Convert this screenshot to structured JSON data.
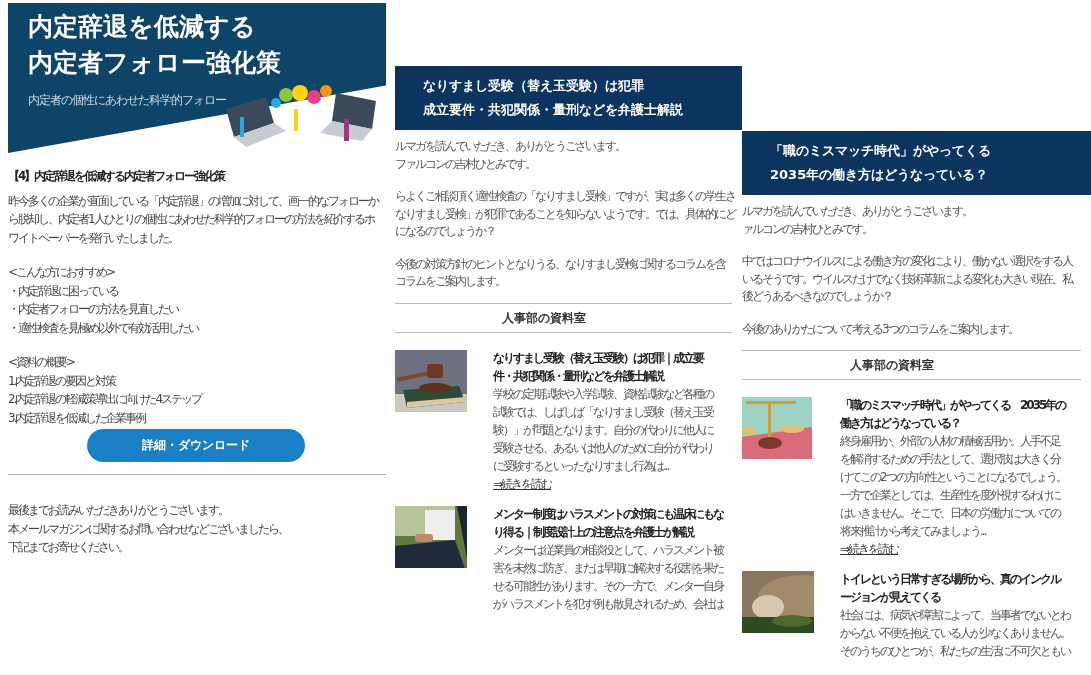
{
  "newsletters": [
    {
      "kind": "whitepaper",
      "banner": {
        "title_lines": [
          "内定辞退を低減する",
          "内定者フォロー強化策"
        ],
        "subtitle": "内定者の個性にあわせた科学的フォロー"
      },
      "heading": "【4】内定辞退を低減する内定者フォロー強化策",
      "intro": "昨今多くの企業が直面している「内定辞退」の増加に対して、画一的なフォローから脱却し、内定者1人ひとりの個性にあわせた科学的フォローの方法を紹介するホワイトペーパーを発行いたしました。",
      "lists": [
        {
          "heading": "<こんな方におすすめ>",
          "items": [
            "・内定辞退に困っている",
            "・内定者フォローの方法を見直したい",
            "・適性検査を見極め以外で有効活用したい"
          ]
        },
        {
          "heading": "<資料の概要>",
          "items": [
            "1.内定辞退の要因と対策",
            "2.内定辞退の軽減策導出に向けた4ステップ",
            "3.内定辞退を低減した企業事例"
          ]
        }
      ],
      "button": "詳細・ダウンロード",
      "closing": [
        "最後までお読みいただきありがとうございます。",
        "本メールマガジンに関するお問い合わせなどございましたら、",
        "下記までお寄せください。"
      ]
    },
    {
      "kind": "digest",
      "header_lines": [
        "なりすまし受験（替え玉受験）は犯罪",
        "成立要件・共犯関係・量刑などを弁護士解説"
      ],
      "intro": [
        [
          "ルマガを読んでいただき、ありがとうございます。",
          "ファルコンの吉村ひとみです。"
        ],
        [
          "らよくご相談頂く適性検査の「なりすまし受検」ですが、実は多くの学生さ",
          "なりすまし受検」が犯罪であることを知らないようです。では、具体的にど",
          "になるのでしょうか？"
        ],
        [
          "今後の対策方針のヒントとなりうる、なりすまし受検に関するコラムを含",
          "コラムをご案内します。"
        ]
      ],
      "section_title": "人事部の資料室",
      "articles": [
        {
          "title_lines": [
            "なりすまし受験（替え玉受験）は犯罪｜成立要",
            "件・共犯関係・量刑などを弁護士解説"
          ],
          "body_lines": [
            "学校の定期試験や入学試験、資格試験など各種の",
            "試験では、しばしば「なりすまし受験（替え玉受",
            "験）」が問題となります。自分の代わりに他人に",
            "受験させる、あるいは他人のために自分が代わり",
            "に受験するといったなりすまし行為は..."
          ],
          "link": "⇒続きを読む"
        },
        {
          "title_lines": [
            "メンター制度はハラスメントの対策にも温床にもな",
            "り得る｜制度設計上の注意点を弁護士が解説"
          ],
          "body_lines": [
            "メンターは従業員の相談役として、ハラスメント被",
            "害を未然に防ぎ、または早期に解決する役割を果た",
            "せる可能性があります。その一方で、メンター自身",
            "がハラスメントを犯す例も散見されるため、会社は"
          ]
        }
      ]
    },
    {
      "kind": "digest",
      "header_lines": [
        "「職のミスマッチ時代」がやってくる",
        "2035年の働き方はどうなっている？"
      ],
      "intro": [
        [
          "ルマガを読んでいただき、ありがとうございます。",
          "ァルコンの吉村ひとみです。"
        ],
        [
          "中ではコロナウイルスによる働き方の変化により、働かない選択をする人",
          "いるそうです。ウイルスだけでなく技術革新による変化も大きい現在、私",
          "後どうあるべきなのでしょうか？"
        ],
        [
          "今後のありかたについて考える3つのコラムをご案内します。"
        ]
      ],
      "section_title": "人事部の資料室",
      "articles": [
        {
          "title_lines": [
            "「職のミスマッチ時代」がやってくる　2035年の",
            "働き方はどうなっている？"
          ],
          "body_lines": [
            "終身雇用か、外部の人材の積極活用か。人手不足",
            "を解消するための手法として、選択肢は大きく分",
            "けてこの2つの方向性ということになるでしょう。",
            "一方で企業としては、生産性を度外視するわけに",
            "はいきません。そこで、日本の労働力についての",
            "将来推計から考えてみましょう..."
          ],
          "link": "⇒続きを読む"
        },
        {
          "title_lines": [
            "トイレという日常すぎる場所から、真のインクル",
            "ージョンが見えてくる"
          ],
          "body_lines": [
            "社会には、病気や障害によって、当事者でないとわ",
            "からない不便を抱えている人が少なくありません。",
            "そのうちのひとつが、私たちの生活に不可欠ともい"
          ]
        }
      ]
    }
  ]
}
